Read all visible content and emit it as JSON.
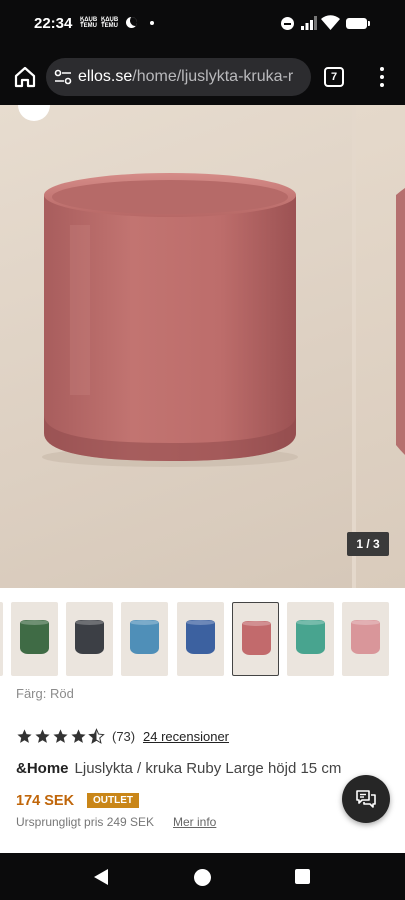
{
  "status_bar": {
    "time": "22:34",
    "notif_1_top": "šАҠБ",
    "notif_1_label_a": "ӃΔŲΒ",
    "notif_1_label_b": "TEMU",
    "notif_2_label_a": "ӃΔŲΒ",
    "notif_2_label_b": "TEMU",
    "icons": [
      "moon-icon",
      "dot-icon",
      "dnd-icon",
      "signal-icon",
      "wifi-icon",
      "battery-icon"
    ]
  },
  "browser": {
    "url_host": "ellos.se",
    "url_path": "/home/ljuslykta-kruka-r",
    "tab_count": "7"
  },
  "product": {
    "image_counter": "1 / 3",
    "thumbnails": [
      {
        "color": "#3f6b45",
        "selected": false
      },
      {
        "color": "#3c3f45",
        "selected": false
      },
      {
        "color": "#4f8fb8",
        "selected": false
      },
      {
        "color": "#3c61a0",
        "selected": false
      },
      {
        "color": "#c26a6c",
        "selected": true
      },
      {
        "color": "#48a48f",
        "selected": false
      },
      {
        "color": "#d9969a",
        "selected": false
      }
    ],
    "color_label": "Färg: Röd",
    "rating": 4.5,
    "rating_count": "(73)",
    "reviews_link": "24 recensioner",
    "brand": "&Home",
    "title": "Ljuslykta / kruka Ruby Large höjd 15 cm",
    "price": "174 SEK",
    "badge": "OUTLET",
    "original_price": "Ursprungligt pris 249 SEK",
    "more_info": "Mer info"
  },
  "colors": {
    "accent_price": "#c0660a",
    "badge_bg": "#c98618",
    "vase": "#bb6d6b"
  }
}
